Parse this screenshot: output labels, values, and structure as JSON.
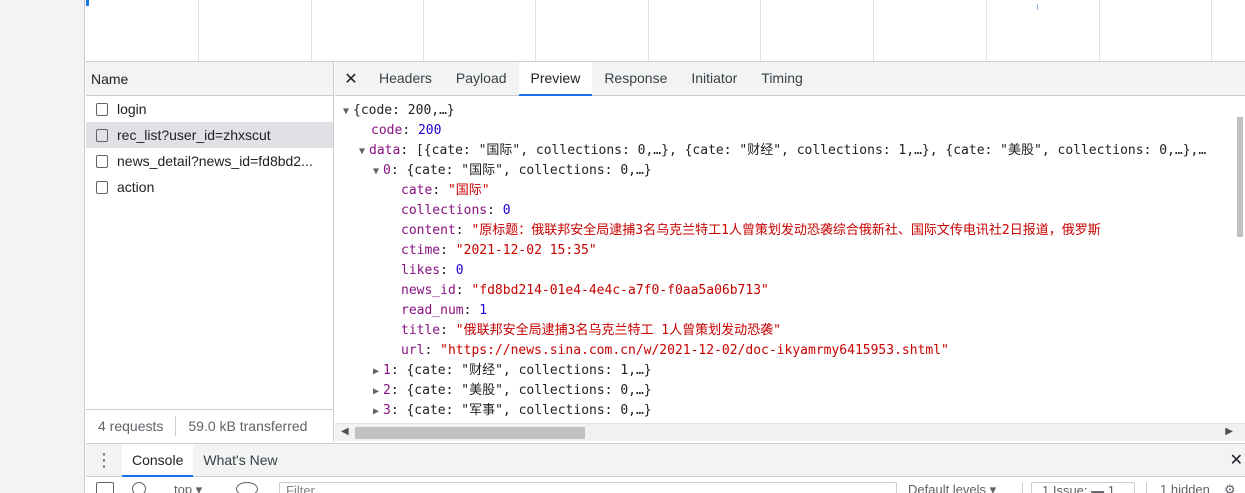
{
  "request_list": {
    "header": "Name",
    "items": [
      {
        "name": "login"
      },
      {
        "name": "rec_list?user_id=zhxscut"
      },
      {
        "name": "news_detail?news_id=fd8bd2..."
      },
      {
        "name": "action"
      }
    ],
    "selected": 1,
    "footer": {
      "requests": "4 requests",
      "transferred": "59.0 kB transferred"
    }
  },
  "detail_tabs": {
    "close_glyph": "✕",
    "tabs": [
      "Headers",
      "Payload",
      "Preview",
      "Response",
      "Initiator",
      "Timing"
    ],
    "active": "Preview"
  },
  "preview": {
    "root_summary": "{code: 200,…}",
    "code_key": "code",
    "code_value": "200",
    "data_key": "data",
    "data_summary": "[{cate: \"国际\", collections: 0,…}, {cate: \"财经\", collections: 1,…}, {cate: \"美股\", collections: 0,…},…",
    "item0_key": "0",
    "item0_summary": "{cate: \"国际\", collections: 0,…}",
    "fields": [
      {
        "key": "cate",
        "value": "\"国际\"",
        "type": "str"
      },
      {
        "key": "collections",
        "value": "0",
        "type": "num"
      },
      {
        "key": "content",
        "value": "\"原标题：俄联邦安全局逮捕3名乌克兰特工1人曾策划发动恐袭综合俄新社、国际文传电讯社2日报道，俄罗斯",
        "type": "str"
      },
      {
        "key": "ctime",
        "value": "\"2021-12-02 15:35\"",
        "type": "str"
      },
      {
        "key": "likes",
        "value": "0",
        "type": "num"
      },
      {
        "key": "news_id",
        "value": "\"fd8bd214-01e4-4e4c-a7f0-f0aa5a06b713\"",
        "type": "str"
      },
      {
        "key": "read_num",
        "value": "1",
        "type": "num"
      },
      {
        "key": "title",
        "value": "\"俄联邦安全局逮捕3名乌克兰特工 1人曾策划发动恐袭\"",
        "type": "str"
      },
      {
        "key": "url",
        "value": "\"https://news.sina.com.cn/w/2021-12-02/doc-ikyamrmy6415953.shtml\"",
        "type": "str"
      }
    ],
    "collapsed_items": [
      {
        "key": "1",
        "summary": "{cate: \"财经\", collections: 1,…}"
      },
      {
        "key": "2",
        "summary": "{cate: \"美股\", collections: 0,…}"
      },
      {
        "key": "3",
        "summary": "{cate: \"军事\", collections: 0,…}"
      }
    ]
  },
  "drawer": {
    "menu_glyph": "⋮",
    "tabs": [
      "Console",
      "What's New"
    ],
    "active": "Console",
    "close_glyph": "✕"
  },
  "console_toolbar": {
    "context": "top ▾",
    "filter_placeholder": "Filter",
    "levels": "Default levels ▾",
    "issues": "1 Issue: ▬ 1",
    "hidden": "1 hidden"
  },
  "colors": {
    "accent": "#1a73e8",
    "json_key": "#881280",
    "json_string": "#c80000",
    "json_number": "#1c00cf"
  }
}
